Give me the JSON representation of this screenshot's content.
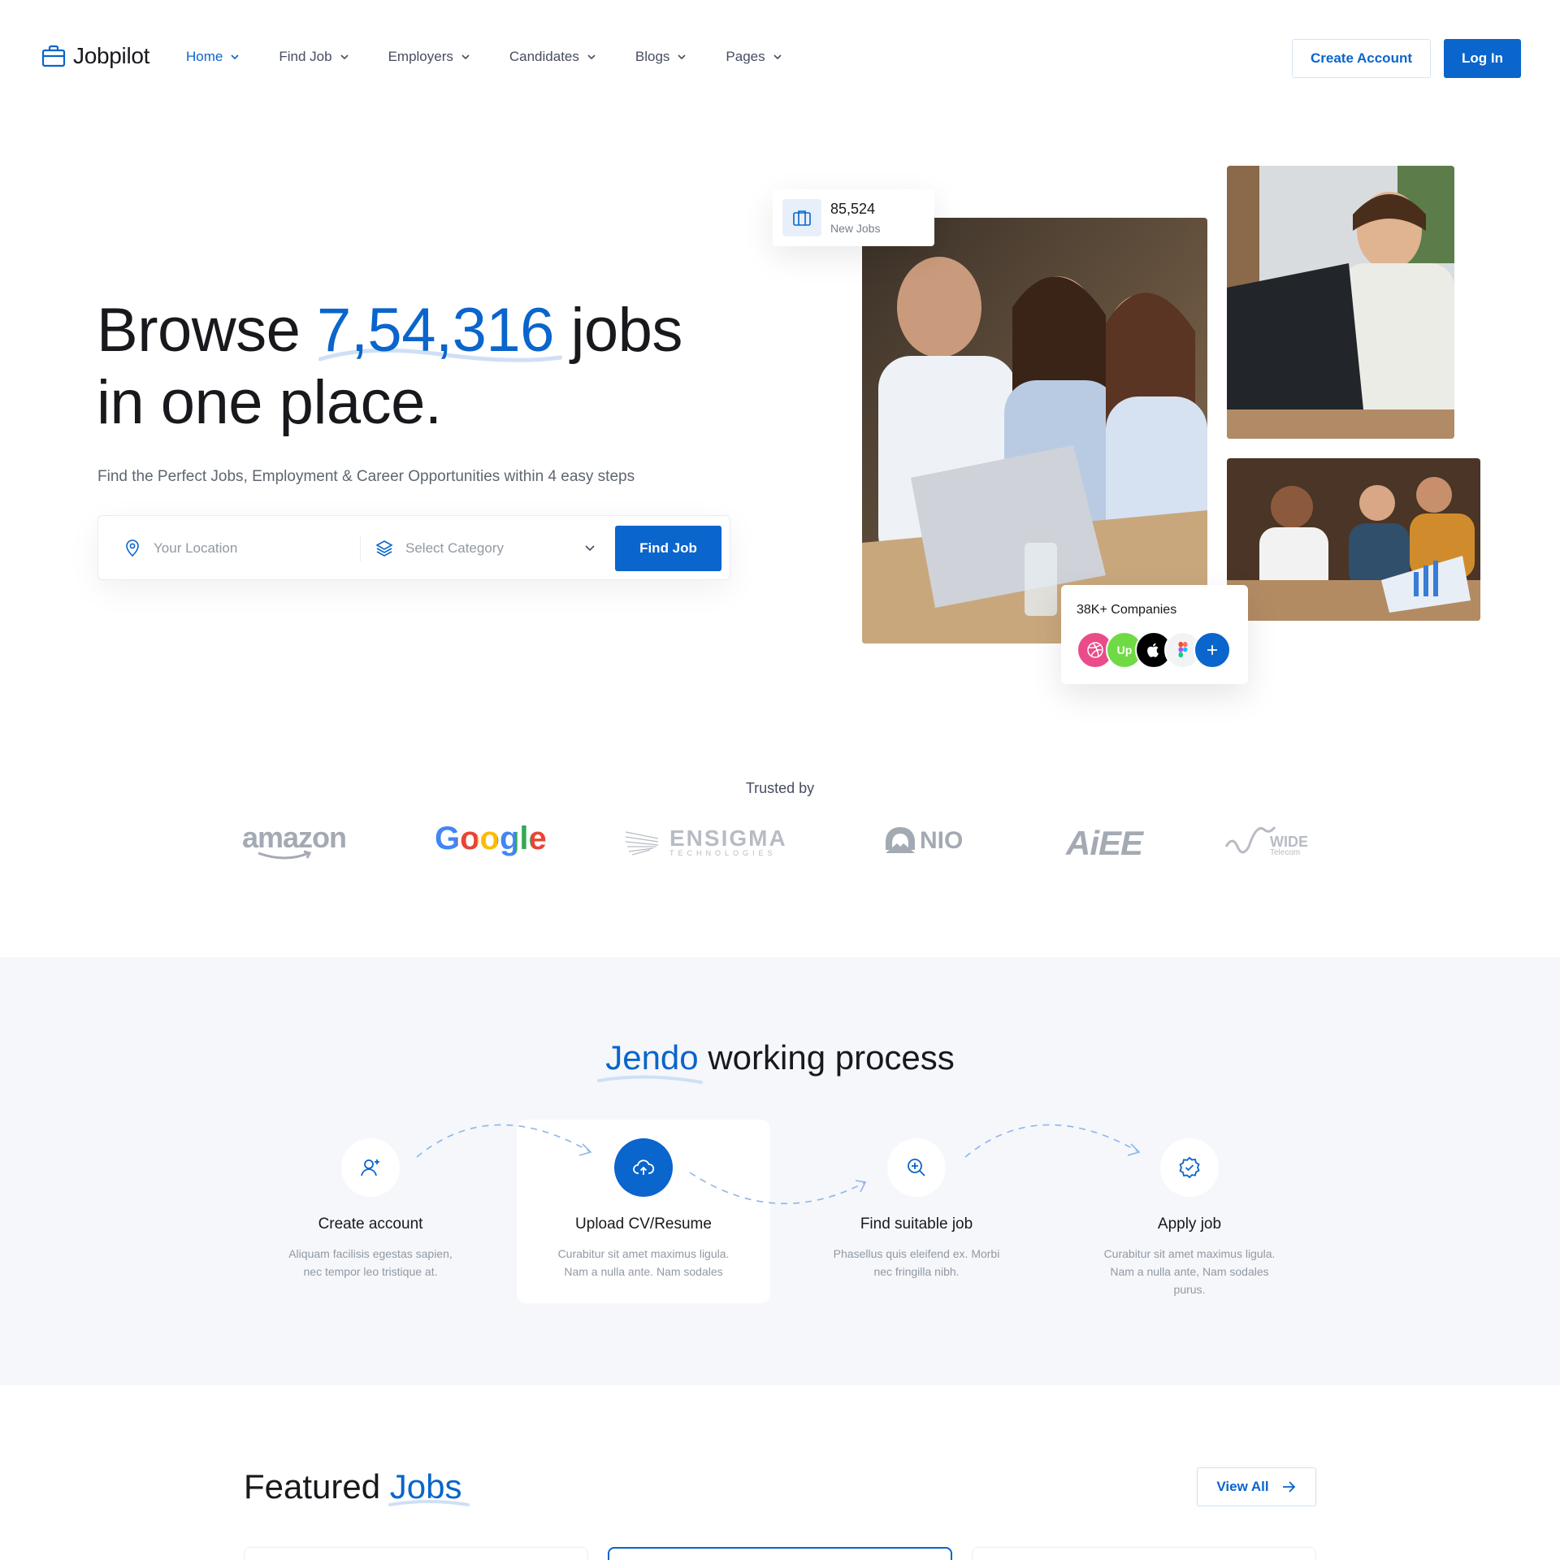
{
  "nav": {
    "logo": "Jobpilot",
    "menu": [
      {
        "label": "Home",
        "active": true
      },
      {
        "label": "Find Job"
      },
      {
        "label": "Employers"
      },
      {
        "label": "Candidates"
      },
      {
        "label": "Blogs"
      },
      {
        "label": "Pages"
      }
    ],
    "create_account": "Create Account",
    "login": "Log In"
  },
  "hero": {
    "title_pre": "Browse ",
    "title_highlight": "7,54,316",
    "title_post": " jobs",
    "title_line2": "in one place.",
    "subtitle": "Find the Perfect Jobs, Employment & Career Opportunities within 4 easy steps",
    "location_placeholder": "Your Location",
    "category_placeholder": "Select Category",
    "find_button": "Find Job",
    "stat_number": "85,524",
    "stat_label": "New Jobs",
    "companies_label": "38K+ Companies",
    "company_avatars": [
      "dribbble-icon",
      "upwork-icon",
      "apple-icon",
      "figma-icon",
      "plus-icon"
    ]
  },
  "trusted": {
    "label": "Trusted by",
    "brands": [
      "amazon",
      "Google",
      "ENSIGMA",
      "TECHNOLOGIES",
      "NIO",
      "AiEE",
      "WIDE",
      "Telecom"
    ]
  },
  "process": {
    "title_highlight": "Jendo",
    "title_rest": " working process",
    "steps": [
      {
        "title": "Create account",
        "desc": "Aliquam facilisis egestas sapien, nec tempor leo tristique at.",
        "icon": "user-add-icon"
      },
      {
        "title": "Upload CV/Resume",
        "desc": "Curabitur sit amet maximus ligula. Nam a nulla ante. Nam sodales",
        "icon": "cloud-upload-icon"
      },
      {
        "title": "Find suitable job",
        "desc": "Phasellus quis eleifend ex. Morbi nec fringilla nibh.",
        "icon": "search-plus-icon"
      },
      {
        "title": "Apply job",
        "desc": "Curabitur sit amet maximus ligula. Nam a nulla ante, Nam sodales purus.",
        "icon": "check-badge-icon"
      }
    ]
  },
  "featured": {
    "title_pre": "Featured ",
    "title_highlight": "Jobs",
    "view_all": "View All"
  },
  "colors": {
    "accent": "#0a65cc",
    "process_bg": "#f5f7fb"
  }
}
